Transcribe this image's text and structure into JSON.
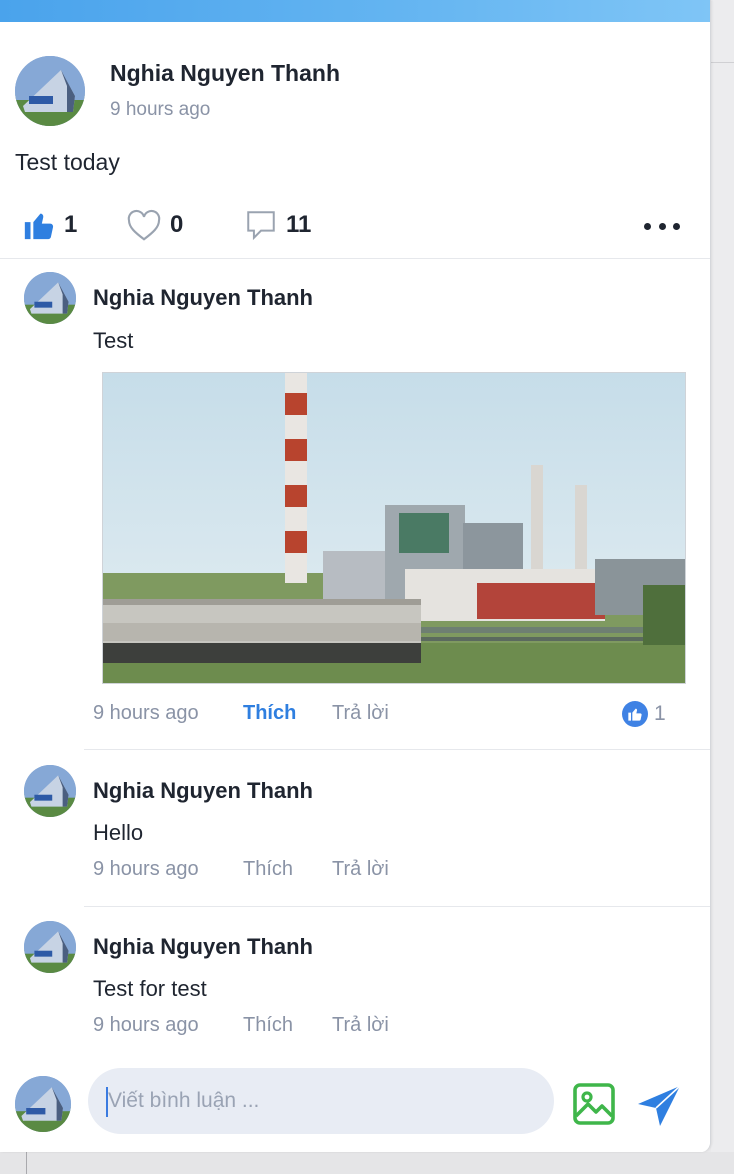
{
  "post": {
    "author": "Nghia  Nguyen Thanh",
    "time": "9 hours ago",
    "content": "Test today",
    "likes": "1",
    "hearts": "0",
    "comments": "11"
  },
  "comments": [
    {
      "author": "Nghia  Nguyen Thanh",
      "text": "Test",
      "time": "9 hours ago",
      "like_label": "Thích",
      "reply_label": "Trả lời",
      "like_count": "1",
      "liked": true
    },
    {
      "author": "Nghia  Nguyen Thanh",
      "text": "Hello",
      "time": "9 hours ago",
      "like_label": "Thích",
      "reply_label": "Trả lời"
    },
    {
      "author": "Nghia  Nguyen Thanh",
      "text": "Test for test",
      "time": "9 hours ago",
      "like_label": "Thích",
      "reply_label": "Trả lời"
    }
  ],
  "composer": {
    "placeholder": "Viết bình luận ..."
  },
  "colors": {
    "accent": "#2f7fe0",
    "image_icon": "#3fb64a"
  }
}
